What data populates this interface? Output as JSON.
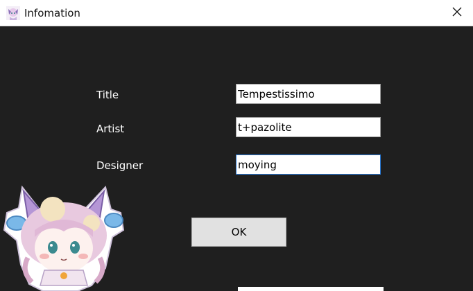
{
  "window": {
    "title": "Infomation"
  },
  "form": {
    "fields": [
      {
        "label": "Title",
        "value": "Tempestissimo"
      },
      {
        "label": "Artist",
        "value": "t+pazolite"
      },
      {
        "label": "Designer",
        "value": "moying"
      }
    ],
    "ok_label": "OK"
  },
  "icons": {
    "app": "anime-girl-app-icon",
    "close": "close-icon",
    "mascot": "chibi-mascot-image"
  },
  "colors": {
    "background": "#1f1f1f",
    "titlebar": "#ffffff",
    "focus_border": "#2b7bd6",
    "button": "#e1e1e1"
  }
}
